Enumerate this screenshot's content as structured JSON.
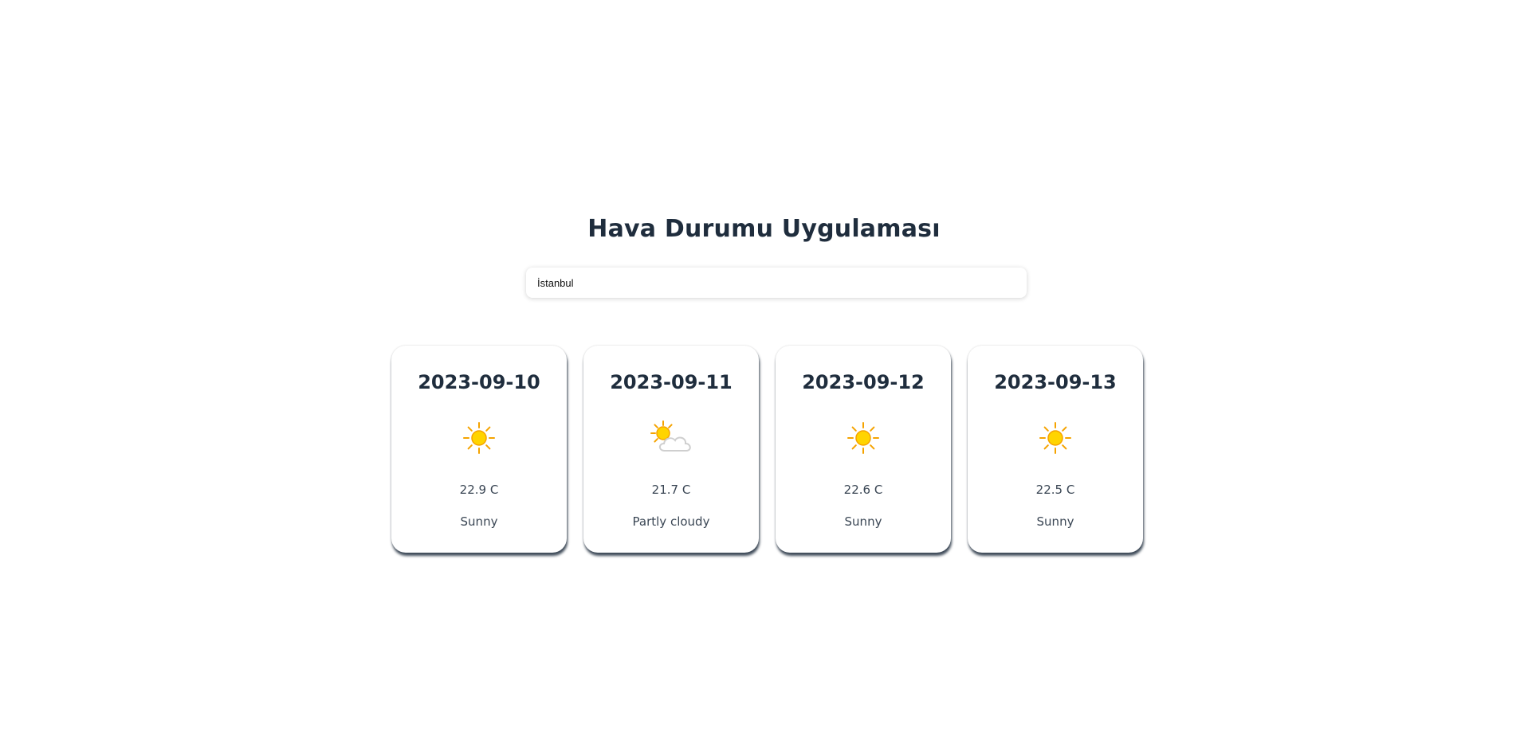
{
  "app": {
    "title": "Hava Durumu Uygulaması"
  },
  "search": {
    "value": "İstanbul"
  },
  "forecast": [
    {
      "date": "2023-09-10",
      "icon": "sun-icon",
      "temp": "22.9 C",
      "condition": "Sunny"
    },
    {
      "date": "2023-09-11",
      "icon": "partly-cloudy-icon",
      "temp": "21.7 C",
      "condition": "Partly cloudy"
    },
    {
      "date": "2023-09-12",
      "icon": "sun-icon",
      "temp": "22.6 C",
      "condition": "Sunny"
    },
    {
      "date": "2023-09-13",
      "icon": "sun-icon",
      "temp": "22.5 C",
      "condition": "Sunny"
    }
  ],
  "colors": {
    "text": "#1f2d3d",
    "sun": "#ffd400",
    "sun_ray": "#f5a300",
    "cloud": "#d7d7d7"
  }
}
